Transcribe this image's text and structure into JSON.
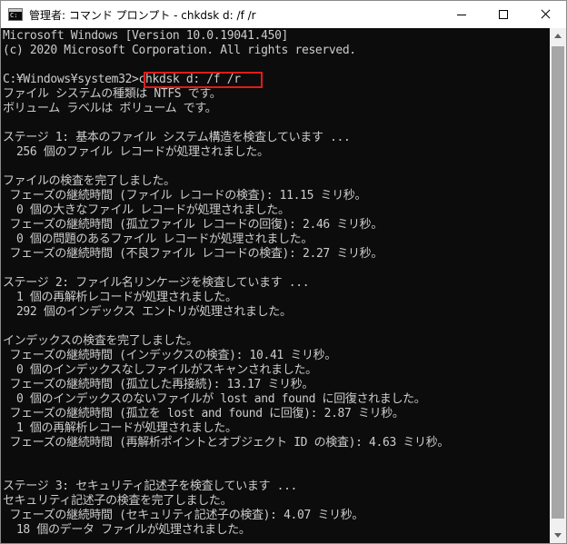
{
  "window": {
    "title": "管理者: コマンド プロンプト - chkdsk  d: /f /r",
    "icon": "console-app-icon",
    "controls": [
      "minimize-icon",
      "maximize-icon",
      "close-icon"
    ]
  },
  "console": {
    "lines": [
      "Microsoft Windows [Version 10.0.19041.450]",
      "(c) 2020 Microsoft Corporation. All rights reserved.",
      "",
      "C:¥Windows¥system32>chkdsk d: /f /r",
      "ファイル システムの種類は NTFS です。",
      "ボリューム ラベルは ボリューム です。",
      "",
      "ステージ 1: 基本のファイル システム構造を検査しています ...",
      "  256 個のファイル レコードが処理されました。",
      "",
      "ファイルの検査を完了しました。",
      " フェーズの継続時間 (ファイル レコードの検査): 11.15 ミリ秒。",
      "  0 個の大きなファイル レコードが処理されました。",
      " フェーズの継続時間 (孤立ファイル レコードの回復): 2.46 ミリ秒。",
      "  0 個の問題のあるファイル レコードが処理されました。",
      " フェーズの継続時間 (不良ファイル レコードの検査): 2.27 ミリ秒。",
      "",
      "ステージ 2: ファイル名リンケージを検査しています ...",
      "  1 個の再解析レコードが処理されました。",
      "  292 個のインデックス エントリが処理されました。",
      "",
      "インデックスの検査を完了しました。",
      " フェーズの継続時間 (インデックスの検査): 10.41 ミリ秒。",
      "  0 個のインデックスなしファイルがスキャンされました。",
      " フェーズの継続時間 (孤立した再接続): 13.17 ミリ秒。",
      "  0 個のインデックスのないファイルが lost and found に回復されました。",
      " フェーズの継続時間 (孤立を lost and found に回復): 2.87 ミリ秒。",
      "  1 個の再解析レコードが処理されました。",
      " フェーズの継続時間 (再解析ポイントとオブジェクト ID の検査): 4.63 ミリ秒。",
      "",
      "",
      "ステージ 3: セキュリティ記述子を検査しています ...",
      "セキュリティ記述子の検査を完了しました。",
      " フェーズの継続時間 (セキュリティ記述子の検査): 4.07 ミリ秒。",
      "  18 個のデータ ファイルが処理されました。"
    ],
    "highlighted_command": "chkdsk d: /f /r"
  },
  "colors": {
    "console_bg": "#0c0c0c",
    "console_text": "#cccccc",
    "highlight_border": "#e21b1b"
  }
}
